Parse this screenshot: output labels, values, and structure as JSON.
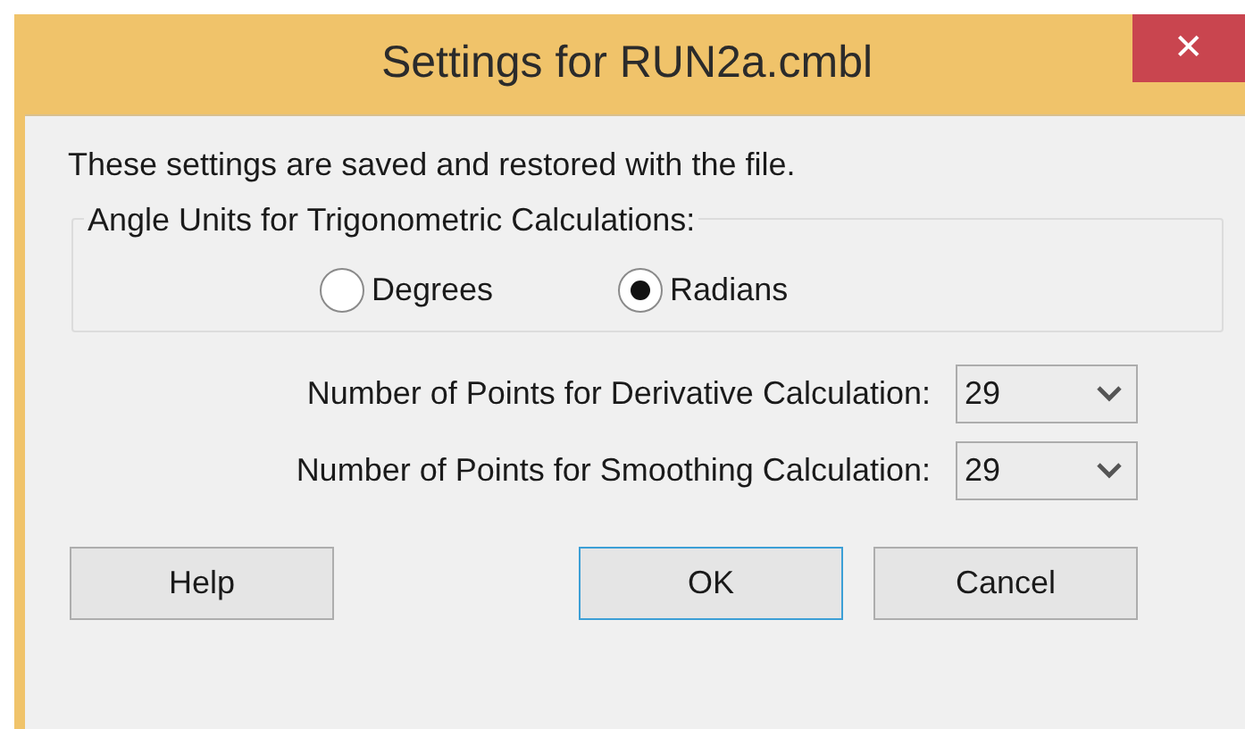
{
  "window": {
    "title": "Settings for RUN2a.cmbl",
    "close": "✕"
  },
  "note": "These settings are saved and restored with the file.",
  "angle_units": {
    "label": "Angle Units for Trigonometric Calculations:",
    "options": [
      {
        "label": "Degrees",
        "selected": false
      },
      {
        "label": "Radians",
        "selected": true
      }
    ]
  },
  "fields": [
    {
      "label": "Number of Points for Derivative Calculation:",
      "value": "29"
    },
    {
      "label": "Number of Points for Smoothing Calculation:",
      "value": "29"
    }
  ],
  "buttons": [
    {
      "label": "Help",
      "kind": "plain"
    },
    {
      "label": "OK",
      "kind": "default"
    },
    {
      "label": "Cancel",
      "kind": "plain"
    }
  ]
}
